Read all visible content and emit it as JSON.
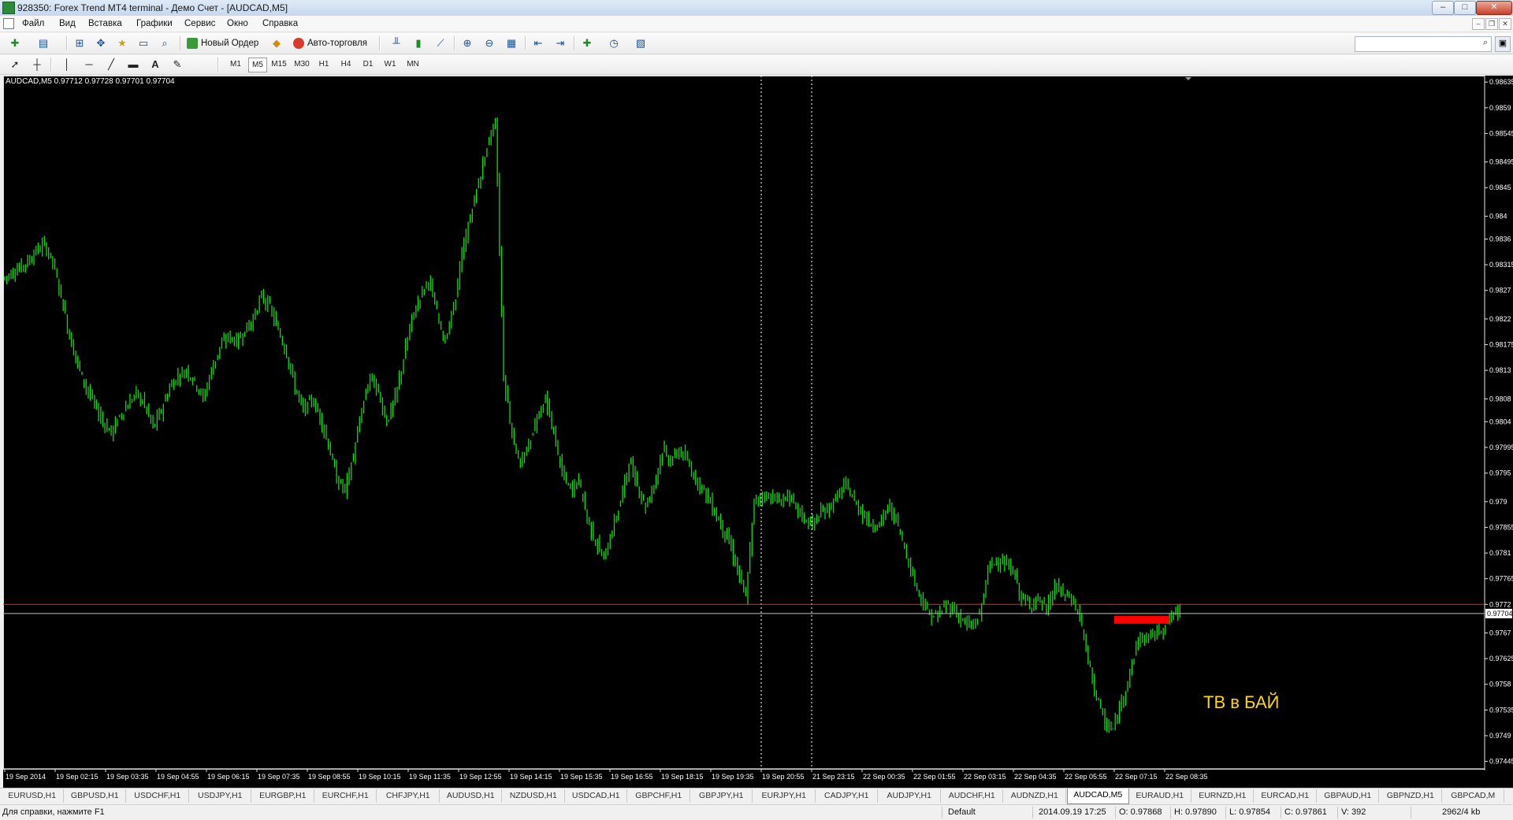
{
  "window": {
    "title": "928350: Forex Trend MT4 terminal - Демо Счет - [AUDCAD,M5]",
    "controls": {
      "minimize": "–",
      "maximize": "□",
      "close": "✕"
    }
  },
  "menu": {
    "items": [
      "Файл",
      "Вид",
      "Вставка",
      "Графики",
      "Сервис",
      "Окно",
      "Справка"
    ],
    "mdi_controls": {
      "minimize": "–",
      "restore": "❐",
      "close": "✕"
    }
  },
  "toolbar": {
    "new_order_label": "Новый Ордер",
    "autotrading_label": "Авто-торговля",
    "search": {
      "value": "",
      "placeholder": ""
    }
  },
  "timeframes": {
    "items": [
      "M1",
      "M5",
      "M15",
      "M30",
      "H1",
      "H4",
      "D1",
      "W1",
      "MN"
    ],
    "active": "M5"
  },
  "chart": {
    "header_label": "AUDCAD,M5  0.97712 0.97728 0.97701 0.97704",
    "annotation_text": "ТВ в БАЙ",
    "colors": {
      "background": "#000000",
      "candles": "#00e600",
      "ask_line": "#ff2020",
      "bid_line": "#c0c0c0",
      "grid": "#ffffff",
      "annotation": "#ffd700",
      "marker": "#ff0000"
    }
  },
  "chart_data": {
    "type": "line",
    "title": "AUDCAD,M5",
    "header_values": {
      "open": 0.97712,
      "high": 0.97728,
      "low": 0.97701,
      "close": 0.97704
    },
    "y_ticks": [
      0.98635,
      0.9859,
      0.98545,
      0.98495,
      0.9845,
      0.984,
      0.9836,
      0.98315,
      0.9827,
      0.9822,
      0.98175,
      0.9813,
      0.9808,
      0.9804,
      0.97995,
      0.9795,
      0.979,
      0.97855,
      0.9781,
      0.97765,
      0.9772,
      0.9767,
      0.97625,
      0.9758,
      0.97535,
      0.9749,
      0.97445
    ],
    "ylim": [
      0.97432,
      0.98638
    ],
    "current_price_label": "0.97704",
    "ask_price": 0.9772,
    "bid_price": 0.97704,
    "x_labels": [
      "19 Sep 2014",
      "19 Sep 02:15",
      "19 Sep 03:35",
      "19 Sep 04:55",
      "19 Sep 06:15",
      "19 Sep 07:35",
      "19 Sep 08:55",
      "19 Sep 10:15",
      "19 Sep 11:35",
      "19 Sep 12:55",
      "19 Sep 14:15",
      "19 Sep 15:35",
      "19 Sep 16:55",
      "19 Sep 18:15",
      "19 Sep 19:35",
      "19 Sep 20:55",
      "21 Sep 23:15",
      "22 Sep 00:35",
      "22 Sep 01:55",
      "22 Sep 03:15",
      "22 Sep 04:35",
      "22 Sep 05:55",
      "22 Sep 07:15",
      "22 Sep 08:35"
    ],
    "series": [
      {
        "values": [
          0.9829,
          0.983,
          0.9831,
          0.9832,
          0.9834,
          0.9835,
          0.9832,
          0.9826,
          0.9819,
          0.9814,
          0.981,
          0.9807,
          0.9804,
          0.9802,
          0.9805,
          0.9807,
          0.9809,
          0.9807,
          0.9803,
          0.9806,
          0.981,
          0.9812,
          0.9813,
          0.9811,
          0.9808,
          0.9813,
          0.9817,
          0.9819,
          0.9818,
          0.982,
          0.9822,
          0.9826,
          0.9824,
          0.982,
          0.9816,
          0.981,
          0.9806,
          0.9808,
          0.9805,
          0.98,
          0.9794,
          0.9792,
          0.9798,
          0.9806,
          0.9812,
          0.9809,
          0.9804,
          0.9808,
          0.9815,
          0.9822,
          0.9826,
          0.9829,
          0.9823,
          0.9818,
          0.9824,
          0.9833,
          0.984,
          0.9846,
          0.9852,
          0.9857,
          0.9812,
          0.9802,
          0.9796,
          0.98,
          0.9805,
          0.9808,
          0.9802,
          0.9795,
          0.9792,
          0.9794,
          0.9787,
          0.9783,
          0.978,
          0.9785,
          0.979,
          0.9797,
          0.9793,
          0.9789,
          0.9793,
          0.9799,
          0.9797,
          0.9799,
          0.9797,
          0.9794,
          0.9792,
          0.9789,
          0.9786,
          0.9783,
          0.9778,
          0.9773,
          0.979,
          0.9791,
          0.9791,
          0.979,
          0.9791,
          0.9789,
          0.9787,
          0.9786,
          0.9788,
          0.9789,
          0.9791,
          0.9793,
          0.979,
          0.9788,
          0.9786,
          0.9786,
          0.9789,
          0.9787,
          0.9782,
          0.9777,
          0.9773,
          0.977,
          0.977,
          0.9772,
          0.9771,
          0.9769,
          0.9768,
          0.977,
          0.9778,
          0.978,
          0.9779,
          0.9778,
          0.9773,
          0.9772,
          0.9773,
          0.9771,
          0.9775,
          0.9774,
          0.9773,
          0.977,
          0.9762,
          0.9756,
          0.9751,
          0.975,
          0.9755,
          0.976,
          0.9766,
          0.9766,
          0.9767,
          0.9768,
          0.977,
          0.9771
        ]
      }
    ],
    "marker": {
      "price": 0.97693,
      "x_label": "22 Sep 07:15"
    },
    "vertical_separators": [
      "19 Sep 20:55",
      "21 Sep 23:15"
    ],
    "grid": false
  },
  "symbol_tabs": {
    "items": [
      "EURUSD,H1",
      "GBPUSD,H1",
      "USDCHF,H1",
      "USDJPY,H1",
      "EURGBP,H1",
      "EURCHF,H1",
      "CHFJPY,H1",
      "AUDUSD,H1",
      "NZDUSD,H1",
      "USDCAD,H1",
      "GBPCHF,H1",
      "GBPJPY,H1",
      "EURJPY,H1",
      "CADJPY,H1",
      "AUDJPY,H1",
      "AUDCHF,H1",
      "AUDNZD,H1",
      "AUDCAD,M5",
      "EURAUD,H1",
      "EURNZD,H1",
      "EURCAD,H1",
      "GBPAUD,H1",
      "GBPNZD,H1",
      "GBPCAD,M"
    ],
    "active": "AUDCAD,M5"
  },
  "status": {
    "help_text": "Для справки, нажмите F1",
    "profile": "Default",
    "datetime": "2014.09.19 17:25",
    "open": "O: 0.97868",
    "high": "H: 0.97890",
    "low": "L: 0.97854",
    "close": "C: 0.97861",
    "volume": "V: 392",
    "traffic": "2962/4 kb"
  }
}
